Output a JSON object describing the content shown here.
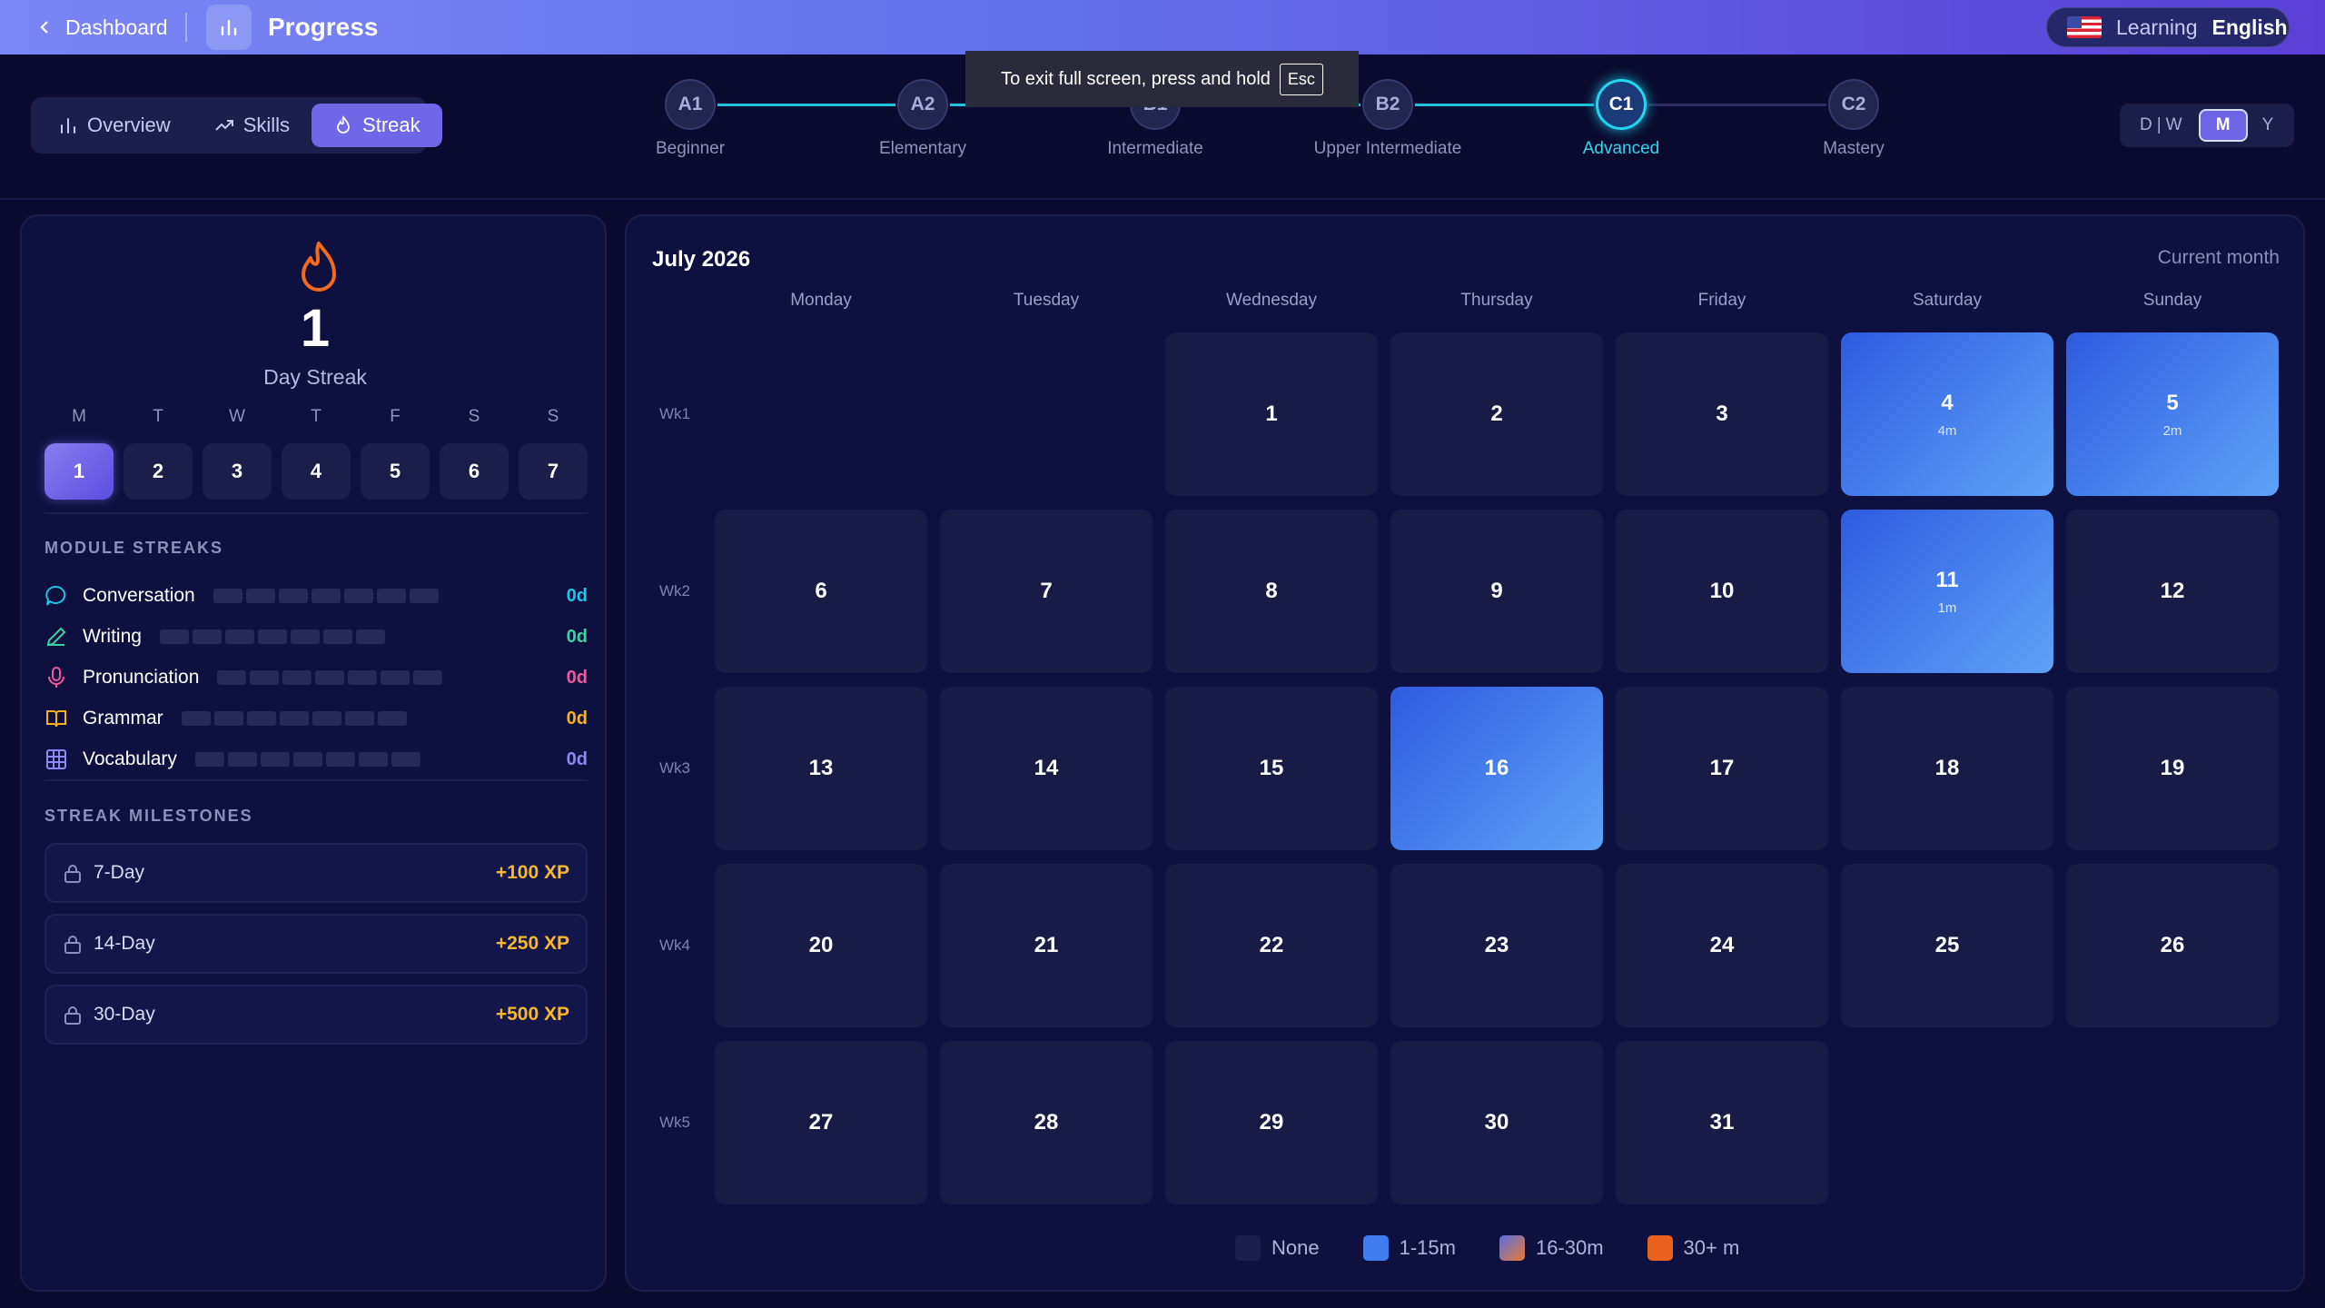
{
  "topbar": {
    "back_label": "Dashboard",
    "title": "Progress",
    "language_prefix": "Learning",
    "language": "English"
  },
  "toast": {
    "text": "To exit full screen, press and hold",
    "key": "Esc"
  },
  "tabs": [
    {
      "label": "Overview",
      "icon": "bar-chart-icon",
      "active": false
    },
    {
      "label": "Skills",
      "icon": "trend-up-icon",
      "active": false
    },
    {
      "label": "Streak",
      "icon": "flame-icon",
      "active": true
    }
  ],
  "levels": [
    {
      "code": "A1",
      "name": "Beginner"
    },
    {
      "code": "A2",
      "name": "Elementary"
    },
    {
      "code": "B1",
      "name": "Intermediate"
    },
    {
      "code": "B2",
      "name": "Upper Intermediate"
    },
    {
      "code": "C1",
      "name": "Advanced",
      "active": true
    },
    {
      "code": "C2",
      "name": "Mastery"
    }
  ],
  "period": {
    "d": "D",
    "w": "W",
    "m": "M",
    "y": "Y",
    "selected": "M"
  },
  "streak": {
    "count": "1",
    "label": "Day Streak",
    "week_letters": [
      "M",
      "T",
      "W",
      "T",
      "F",
      "S",
      "S"
    ],
    "week_days": [
      "1",
      "2",
      "3",
      "4",
      "5",
      "6",
      "7"
    ],
    "active_index": 0
  },
  "module_streaks": {
    "title": "MODULE STREAKS",
    "items": [
      {
        "name": "Conversation",
        "value": "0d",
        "color": "#22c3e6",
        "icon": "chat-bubble-icon"
      },
      {
        "name": "Writing",
        "value": "0d",
        "color": "#3ad29f",
        "icon": "pencil-icon"
      },
      {
        "name": "Pronunciation",
        "value": "0d",
        "color": "#f2569c",
        "icon": "microphone-icon"
      },
      {
        "name": "Grammar",
        "value": "0d",
        "color": "#f6b21e",
        "icon": "book-icon"
      },
      {
        "name": "Vocabulary",
        "value": "0d",
        "color": "#8e86f5",
        "icon": "grid-icon"
      }
    ]
  },
  "milestones": {
    "title": "STREAK MILESTONES",
    "items": [
      {
        "name": "7-Day",
        "xp": "+100 XP"
      },
      {
        "name": "14-Day",
        "xp": "+250 XP"
      },
      {
        "name": "30-Day",
        "xp": "+500 XP"
      }
    ]
  },
  "calendar": {
    "title": "July 2026",
    "note": "Current month",
    "weekdays": [
      "Monday",
      "Tuesday",
      "Wednesday",
      "Thursday",
      "Friday",
      "Saturday",
      "Sunday"
    ],
    "weeks": [
      "Wk1",
      "Wk2",
      "Wk3",
      "Wk4",
      "Wk5"
    ],
    "first_weekday_index": 2,
    "days_in_month": 31,
    "activity": {
      "4": {
        "minutes": "4m",
        "level": 1
      },
      "5": {
        "minutes": "2m",
        "level": 1
      },
      "11": {
        "minutes": "1m",
        "level": 1
      },
      "16": {
        "minutes": "",
        "level": 1
      }
    },
    "legend": [
      {
        "label": "None",
        "color": "#1c1f4d"
      },
      {
        "label": "1-15m",
        "color": "#3f7ef0"
      },
      {
        "label": "16-30m",
        "color": "#a07098"
      },
      {
        "label": "30+ m",
        "color": "#e8621e"
      }
    ]
  }
}
